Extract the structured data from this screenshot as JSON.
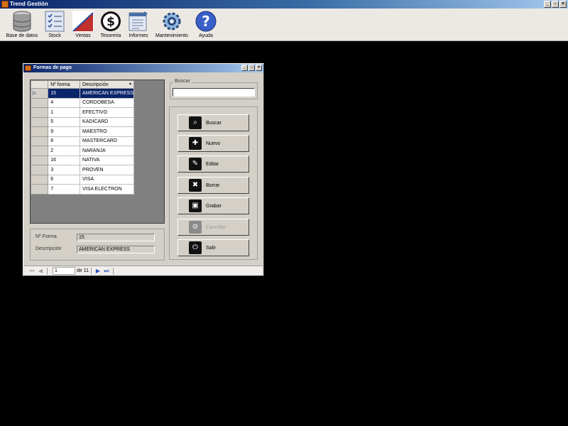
{
  "app": {
    "title": "Trend Gestión"
  },
  "toolbar": [
    {
      "label": "Base de datos",
      "icon": "database-icon"
    },
    {
      "label": "Stock",
      "icon": "checklist-icon"
    },
    {
      "label": "Ventas",
      "icon": "sales-chart-icon"
    },
    {
      "label": "Tesoreria",
      "icon": "dollar-icon"
    },
    {
      "label": "Informes",
      "icon": "report-icon"
    },
    {
      "label": "Mantenimiento",
      "icon": "gear-icon"
    },
    {
      "label": "Ayuda",
      "icon": "help-icon"
    }
  ],
  "child": {
    "title": "Formas de pago",
    "grid": {
      "columns": [
        "Nº forma",
        "Descripción"
      ],
      "rows": [
        {
          "id": "15",
          "desc": "AMERICAN EXPRESS"
        },
        {
          "id": "4",
          "desc": "CORDOBESA"
        },
        {
          "id": "1",
          "desc": "EFECTIVO"
        },
        {
          "id": "5",
          "desc": "KADICARD"
        },
        {
          "id": "9",
          "desc": "MAESTRO"
        },
        {
          "id": "8",
          "desc": "MASTERCARD"
        },
        {
          "id": "2",
          "desc": "NARANJA"
        },
        {
          "id": "16",
          "desc": "NATIVA"
        },
        {
          "id": "3",
          "desc": "PROVEN"
        },
        {
          "id": "6",
          "desc": "VISA"
        },
        {
          "id": "7",
          "desc": "VISA ELECTRON"
        }
      ]
    },
    "search": {
      "legend": "Buscar",
      "value": ""
    },
    "buttons": {
      "buscar": "Buscar",
      "nuevo": "Nuevo",
      "editar": "Editar",
      "borrar": "Borrar",
      "grabar": "Grabar",
      "cancelar": "Cancelar",
      "salir": "Salir"
    },
    "detail": {
      "forma_label": "Nº Forma",
      "forma_value": "15",
      "desc_label": "Descripción",
      "desc_value": "AMERICAN EXPRESS"
    },
    "nav": {
      "page": "1",
      "of_label": "de 11"
    }
  },
  "colors": {
    "selection": "#0a246a",
    "desktop": "#000000",
    "window": "#d4d0c8"
  }
}
